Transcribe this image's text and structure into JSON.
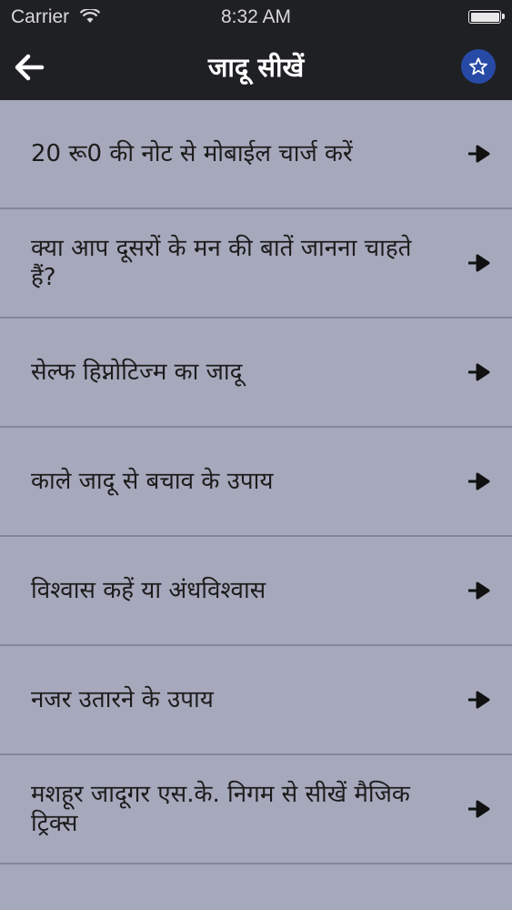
{
  "status": {
    "carrier": "Carrier",
    "time": "8:32 AM"
  },
  "header": {
    "title": "जादू सीखें",
    "back_icon": "back-arrow-icon",
    "star_icon": "star-icon",
    "star_color": "#274aa7"
  },
  "items": [
    {
      "label": "20 रू0 की नोट से मोबाईल चार्ज करें"
    },
    {
      "label": "क्या आप दूसरों के मन की बातें जानना चाहते हैं?"
    },
    {
      "label": "सेल्फ हिप्नोटिज्म का जादू"
    },
    {
      "label": "काले जादू से बचाव के उपाय"
    },
    {
      "label": "विश्वास कहें या अंधविश्वास"
    },
    {
      "label": "नजर उतारने के उपाय"
    },
    {
      "label": "मशहूर जादूगर एस.के. निगम से सीखें मैजिक ट्रिक्स"
    }
  ]
}
